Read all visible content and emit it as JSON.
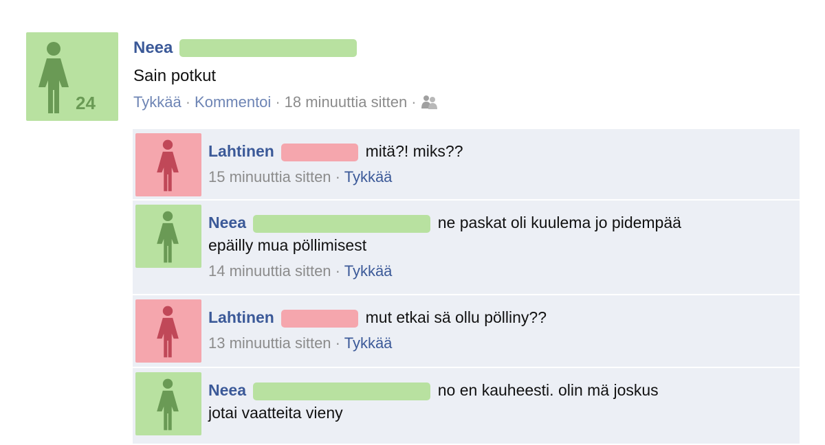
{
  "post": {
    "author": "Neea",
    "age_badge": "24",
    "text": "Sain potkut",
    "like_label": "Tykkää",
    "comment_label": "Kommentoi",
    "timestamp": "18 minuuttia sitten",
    "separator": "·",
    "audience_icon": "friends-icon"
  },
  "comments": [
    {
      "author": "Lahtinen",
      "text": "mitä?! miks??",
      "time": "15 minuuttia sitten",
      "like_label": "Tykkää",
      "avatar_color": "#f5a6ad"
    },
    {
      "author": "Neea",
      "text_line1": "ne paskat oli kuulema jo pidempää",
      "text_line2": "epäilly mua pöllimisest",
      "time": "14 minuuttia sitten",
      "like_label": "Tykkää",
      "avatar_color": "#b8e1a0"
    },
    {
      "author": "Lahtinen",
      "text": "mut etkai sä ollu pölliny??",
      "time": "13 minuuttia sitten",
      "like_label": "Tykkää",
      "avatar_color": "#f5a6ad"
    },
    {
      "author": "Neea",
      "text_line1": "no en kauheesti. olin mä joskus",
      "text_line2": "jotai vaatteita vieny",
      "avatar_color": "#b8e1a0"
    }
  ],
  "colors": {
    "link": "#3b5998",
    "comment_bg": "#eceff5",
    "female_green": "#b8e1a0",
    "female_pink": "#f5a6ad"
  }
}
